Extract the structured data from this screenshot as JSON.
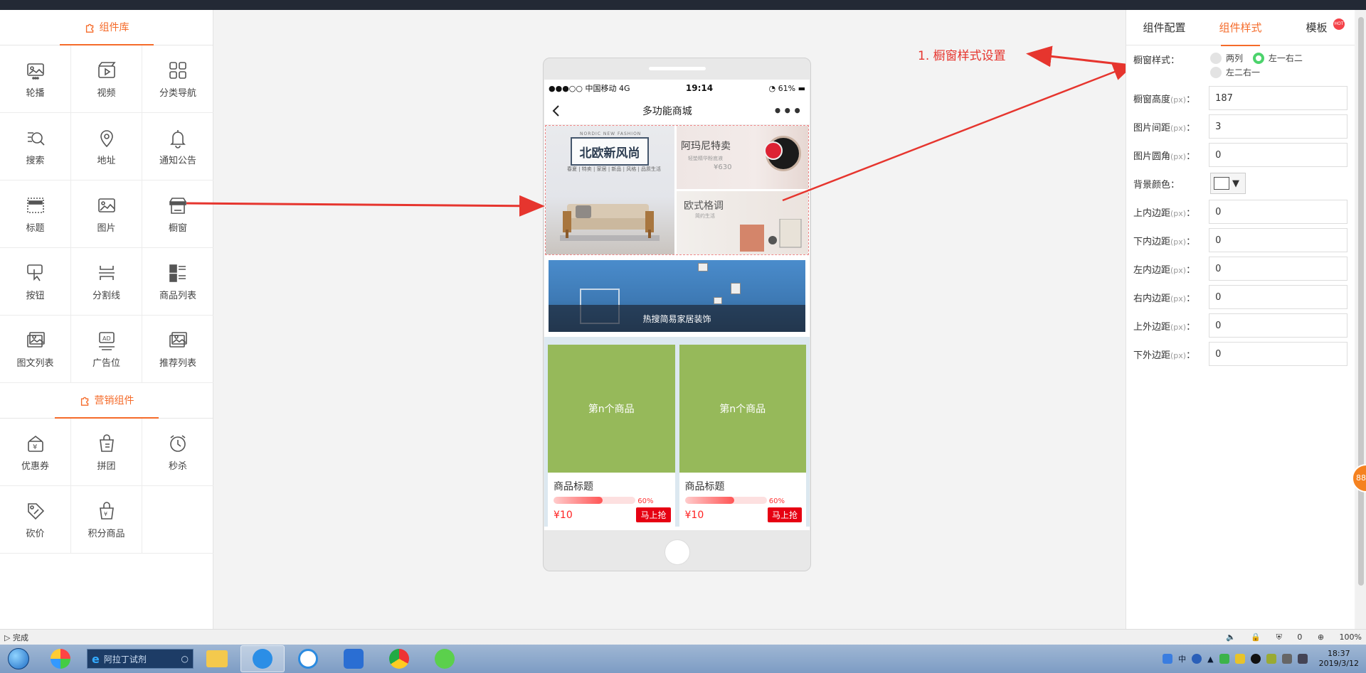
{
  "left_panel": {
    "section1_title": "组件库",
    "components": [
      {
        "label": "轮播",
        "icon": "carousel-icon"
      },
      {
        "label": "视频",
        "icon": "video-icon"
      },
      {
        "label": "分类导航",
        "icon": "category-nav-icon"
      },
      {
        "label": "搜索",
        "icon": "search-icon"
      },
      {
        "label": "地址",
        "icon": "location-icon"
      },
      {
        "label": "通知公告",
        "icon": "bell-icon"
      },
      {
        "label": "标题",
        "icon": "title-icon"
      },
      {
        "label": "图片",
        "icon": "image-icon"
      },
      {
        "label": "橱窗",
        "icon": "shop-window-icon"
      },
      {
        "label": "按钮",
        "icon": "button-icon"
      },
      {
        "label": "分割线",
        "icon": "divider-icon"
      },
      {
        "label": "商品列表",
        "icon": "product-list-icon"
      },
      {
        "label": "图文列表",
        "icon": "image-text-list-icon"
      },
      {
        "label": "广告位",
        "icon": "ad-icon"
      },
      {
        "label": "推荐列表",
        "icon": "recommend-list-icon"
      }
    ],
    "section2_title": "营销组件",
    "marketing": [
      {
        "label": "优惠券",
        "icon": "coupon-icon"
      },
      {
        "label": "拼团",
        "icon": "group-buy-icon"
      },
      {
        "label": "秒杀",
        "icon": "alarm-clock-icon"
      },
      {
        "label": "砍价",
        "icon": "bargain-tag-icon"
      },
      {
        "label": "积分商品",
        "icon": "points-bag-icon"
      }
    ]
  },
  "phone": {
    "carrier": "●●●○○ 中国移动  4G",
    "time": "19:14",
    "battery": "61%",
    "page_title": "多功能商城",
    "more": "•••",
    "window": {
      "left_title": "北欧新风尚",
      "left_small": "NORDIC NEW FASHION",
      "left_sub": "春夏 | 特卖 | 家居 | 新品 | 风格 | 品质生活",
      "rt_title": "阿玛尼特卖",
      "rt_sub": "轻垫精华粉底液",
      "rt_price": "¥630",
      "rb_title": "欧式格调",
      "rb_sub": "简约生活"
    },
    "banner_caption": "热搜简易家居装饰",
    "goods": [
      {
        "image_text": "第n个商品",
        "name": "商品标题",
        "progress_label": "60%",
        "progress": 0.6,
        "price": "¥10",
        "buy": "马上抢"
      },
      {
        "image_text": "第n个商品",
        "name": "商品标题",
        "progress_label": "60%",
        "progress": 0.6,
        "price": "¥10",
        "buy": "马上抢"
      }
    ]
  },
  "annotation": "1.  橱窗样式设置",
  "right_panel": {
    "tabs": [
      "组件配置",
      "组件样式",
      "模板"
    ],
    "active_tab": 1,
    "hot_badge": "HOT",
    "style_label": "橱窗样式：",
    "style_options": [
      "两列",
      "左一右二",
      "左二右一"
    ],
    "selected_style": 1,
    "fields": [
      {
        "label": "橱窗高度",
        "unit": "(px)",
        "value": "187"
      },
      {
        "label": "图片间距",
        "unit": "(px)",
        "value": "3"
      },
      {
        "label": "图片圆角",
        "unit": "(px)",
        "value": "0"
      }
    ],
    "bg_color_label": "背景颜色：",
    "bg_color": "#ffffff",
    "padding_fields": [
      {
        "label": "上内边距",
        "unit": "(px)",
        "value": "0"
      },
      {
        "label": "下内边距",
        "unit": "(px)",
        "value": "0"
      },
      {
        "label": "左内边距",
        "unit": "(px)",
        "value": "0"
      },
      {
        "label": "右内边距",
        "unit": "(px)",
        "value": "0"
      },
      {
        "label": "上外边距",
        "unit": "(px)",
        "value": "0"
      },
      {
        "label": "下外边距",
        "unit": "(px)",
        "value": "0"
      }
    ],
    "float_badge": "88"
  },
  "browser_status": {
    "left": "完成",
    "count": "0",
    "zoom": "100%"
  },
  "taskbar": {
    "search_text": "阿拉丁试剂",
    "ime": "中",
    "time": "18:37",
    "date": "2019/3/12"
  },
  "colors": {
    "accent": "#f56b2a",
    "annotation": "#e6352e",
    "goods_bg": "#96b95a",
    "buy_btn": "#e60012"
  }
}
